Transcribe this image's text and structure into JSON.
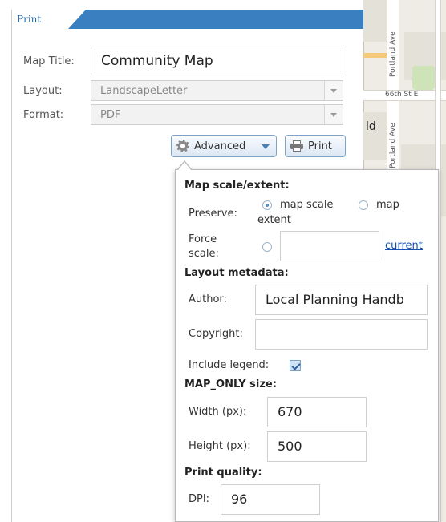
{
  "tab": {
    "label": "Print"
  },
  "form": {
    "map_title_label": "Map Title:",
    "map_title_value": "Community Map",
    "layout_label": "Layout:",
    "layout_value": "LandscapeLetter",
    "format_label": "Format:",
    "format_value": "PDF"
  },
  "buttons": {
    "advanced": "Advanced",
    "print": "Print"
  },
  "advanced": {
    "map_scale_heading": "Map scale/extent:",
    "preserve_label": "Preserve:",
    "preserve_option_scale": "map scale",
    "preserve_option_extent_1": "map",
    "preserve_option_extent_2": "extent",
    "preserve_selected": "map scale",
    "force_scale_label_1": "Force",
    "force_scale_label_2": "scale:",
    "force_scale_value": "",
    "current_link": "current",
    "layout_metadata_heading": "Layout metadata:",
    "author_label": "Author:",
    "author_value": "Local Planning Handb",
    "copyright_label": "Copyright:",
    "copyright_value": "",
    "include_legend_label": "Include legend:",
    "include_legend_checked": true,
    "map_only_heading": "MAP_ONLY size:",
    "width_label": "Width (px):",
    "width_value": "670",
    "height_label": "Height (px):",
    "height_value": "500",
    "print_quality_heading": "Print quality:",
    "dpi_label": "DPI:",
    "dpi_value": "96"
  },
  "map": {
    "street_label_1": "Portland Ave",
    "street_label_2": "66th St E",
    "street_label_3": "Portland Ave",
    "fragment_label": "ld"
  },
  "colors": {
    "tab_bar": "#3a7fbf",
    "link": "#1a4fb3",
    "accent_button_border": "#7aa4cc"
  }
}
